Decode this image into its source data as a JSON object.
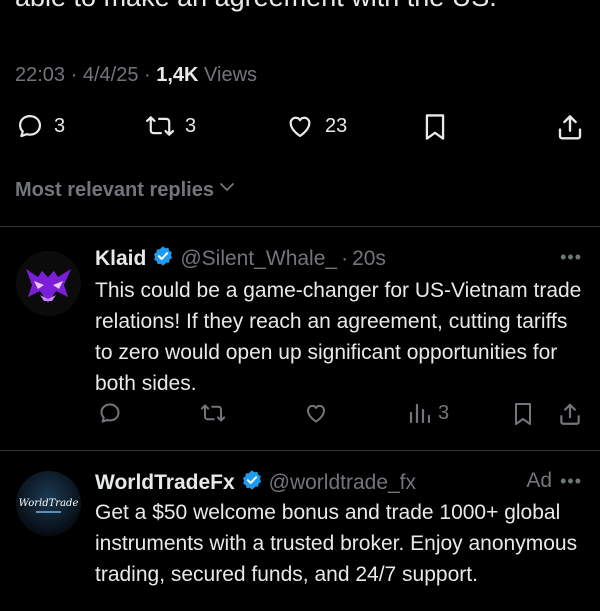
{
  "post": {
    "text_tail": "able to make an agreement with the US.",
    "time": "22:03",
    "date": "4/4/25",
    "views_count": "1,4K",
    "views_label": "Views",
    "replies": "3",
    "reposts": "3",
    "likes": "23"
  },
  "sort_label": "Most relevant replies",
  "replies": [
    {
      "name": "Klaid",
      "handle": "@Silent_Whale_",
      "time": "20s",
      "text": "This could be a game-changer for US-Vietnam trade relations! If they reach an agreement, cutting tariffs to zero would open up significant opportunities for both sides.",
      "views": "3"
    },
    {
      "name": "WorldTradeFx",
      "handle": "@worldtrade_fx",
      "ad_label": "Ad",
      "avatar_text": "WorldTrade",
      "text": "Get a $50 welcome bonus and trade 1000+ global instruments with a trusted broker. Enjoy anonymous trading, secured funds, and 24/7 support."
    }
  ],
  "colors": {
    "background": "#000000",
    "text": "#e7e9ea",
    "muted": "#71767b",
    "divider": "#2f3336",
    "verified": "#1d9bf0",
    "avatar_glow": "#b026ff"
  }
}
